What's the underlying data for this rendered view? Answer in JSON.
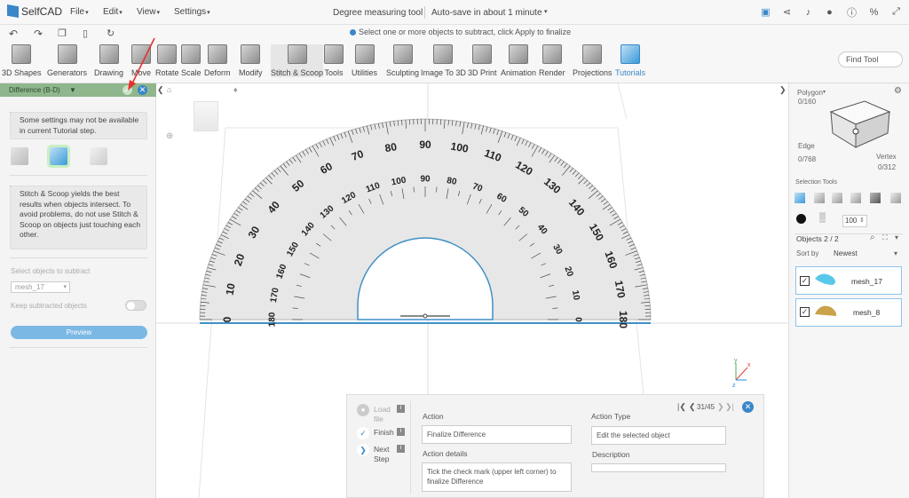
{
  "app": {
    "name": "SelfCAD",
    "menus": [
      "File",
      "Edit",
      "View",
      "Settings"
    ],
    "doc_title": "Degree measuring tool",
    "autosave": "Auto-save in about 1 minute"
  },
  "hint": "Select one or more objects to subtract, click Apply to finalize",
  "toolbar": {
    "tools": [
      "3D Shapes",
      "Generators",
      "Drawing",
      "Move",
      "Rotate",
      "Scale",
      "Deform",
      "Modify",
      "Stitch & Scoop",
      "Tools",
      "Utilities",
      "Sculpting",
      "Image To 3D",
      "3D Print",
      "Animation",
      "Render",
      "Projections",
      "Tutorials"
    ],
    "find_tool": "Find Tool"
  },
  "left_panel": {
    "title": "Difference (B-D)",
    "notice": "Some settings may not be available in current Tutorial step.",
    "tip": "Stitch & Scoop yields the best results when objects intersect. To avoid problems, do not use Stitch & Scoop on objects just touching each other.",
    "select_label": "Select objects to subtract",
    "select_value": "mesh_17",
    "keep_label": "Keep subtracted objects",
    "preview_button": "Preview"
  },
  "right_panel": {
    "polygon_label": "Polygon",
    "polygon_count": "0/160",
    "edge_label": "Edge",
    "edge_count": "0/768",
    "vertex_label": "Vertex",
    "vertex_count": "0/312",
    "selection_tools": "Selection Tools",
    "opacity": "100",
    "objects_label": "Objects 2 / 2",
    "sort_label": "Sort by",
    "sort_value": "Newest",
    "objects": [
      {
        "name": "mesh_17",
        "color": "#58c8ea"
      },
      {
        "name": "mesh_8",
        "color": "#c9a24a"
      }
    ]
  },
  "tutorial": {
    "steps": [
      "Load file",
      "Finish",
      "Next Step"
    ],
    "nav": "31/45",
    "action_label": "Action",
    "action_value": "Finalize Difference",
    "details_label": "Action details",
    "details_value": "Tick the check mark (upper left corner) to finalize Difference",
    "type_label": "Action Type",
    "type_value": "Edit the selected object",
    "description_label": "Description"
  },
  "protractor": {
    "outer": [
      "0",
      "10",
      "20",
      "30",
      "40",
      "50",
      "60",
      "70",
      "80",
      "90",
      "100",
      "110",
      "120",
      "130",
      "140",
      "150",
      "160",
      "170",
      "180"
    ],
    "inner": [
      "180",
      "170",
      "160",
      "150",
      "140",
      "130",
      "120",
      "110",
      "100",
      "90",
      "80",
      "70",
      "60",
      "50",
      "40",
      "30",
      "20",
      "10",
      "0"
    ]
  },
  "axes": {
    "x": "x",
    "y": "y",
    "z": "z"
  },
  "colors": {
    "accent": "#3a86c8",
    "panel_header": "#8fb68c",
    "preview": "#7bb8e4"
  }
}
